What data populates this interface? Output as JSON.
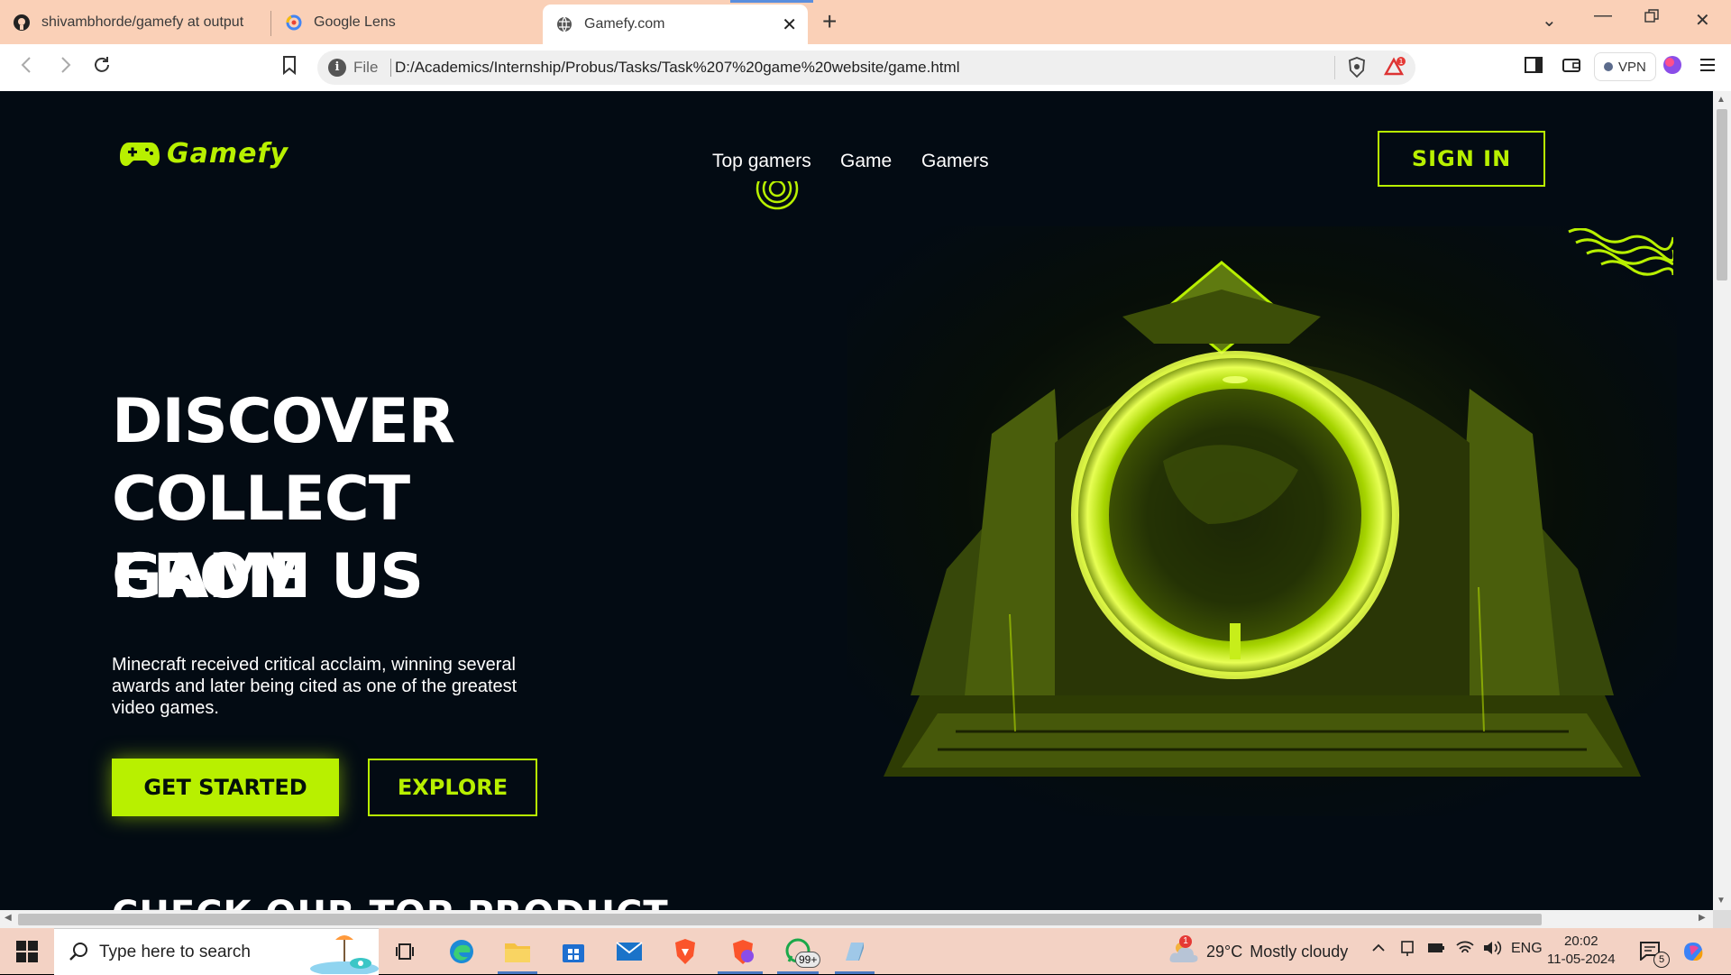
{
  "browser": {
    "tabs": [
      {
        "title": "shivambhorde/gamefy at output",
        "icon": "github-icon"
      },
      {
        "title": "Google Lens",
        "icon": "google-lens-icon"
      },
      {
        "title": "Gamefy.com",
        "icon": "globe-icon",
        "active": true
      }
    ],
    "address": {
      "scheme": "File",
      "url": "D:/Academics/Internship/Probus/Tasks/Task%207%20game%20website/game.html"
    },
    "vpn_label": "VPN"
  },
  "site": {
    "logo_text": "Gamefy",
    "nav": [
      "Top gamers",
      "Game",
      "Gamers"
    ],
    "signin_label": "SIGN IN",
    "hero": {
      "title_lines": [
        "DISCOVER",
        "COLLECT GAME",
        "FROM US"
      ],
      "description": "Minecraft received critical acclaim, winning several awards and later being cited as one of the greatest video games.",
      "primary_cta": "GET STARTED",
      "secondary_cta": "EXPLORE"
    },
    "next_section_title": "CHECK OUR TOP PRODUCT",
    "accent_color": "#b8f000",
    "background_color": "#030b13"
  },
  "taskbar": {
    "search_placeholder": "Type here to search",
    "whatsapp_badge": "99+",
    "weather_badge": "1",
    "weather_temp": "29°C",
    "weather_text": "Mostly cloudy",
    "language": "ENG",
    "time": "20:02",
    "date": "11-05-2024",
    "notification_count": "5"
  }
}
